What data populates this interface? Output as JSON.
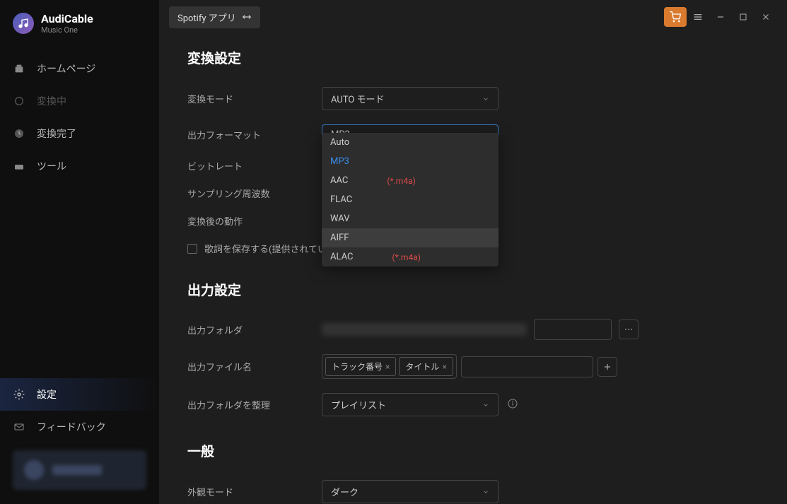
{
  "app": {
    "title": "AudiCable",
    "subtitle": "Music One"
  },
  "nav": {
    "home": "ホームページ",
    "converting": "変換中",
    "converted": "変換完了",
    "tools": "ツール",
    "settings": "設定",
    "feedback": "フィードバック"
  },
  "topbar": {
    "source": "Spotify アプリ"
  },
  "sections": {
    "conversion_settings": "変換設定",
    "output_settings": "出力設定",
    "general": "一般"
  },
  "labels": {
    "convert_mode": "変換モード",
    "output_format": "出力フォーマット",
    "bitrate": "ビットレート",
    "sample_rate": "サンプリング周波数",
    "after_convert": "変換後の動作",
    "save_lyrics": "歌詞を保存する(提供されてい",
    "output_folder": "出力フォルダ",
    "output_filename": "出力ファイル名",
    "organize_output": "出力フォルダを整理",
    "appearance": "外観モード"
  },
  "values": {
    "convert_mode": "AUTO モード",
    "output_format": "MP3",
    "organize_output": "プレイリスト",
    "appearance": "ダーク"
  },
  "filename_tags": {
    "track_number": "トラック番号",
    "title": "タイトル"
  },
  "format_options": {
    "auto": "Auto",
    "mp3": "MP3",
    "aac": "AAC",
    "aac_ext": "(*.m4a)",
    "flac": "FLAC",
    "wav": "WAV",
    "aiff": "AIFF",
    "alac": "ALAC",
    "alac_ext": "(*.m4a)"
  }
}
